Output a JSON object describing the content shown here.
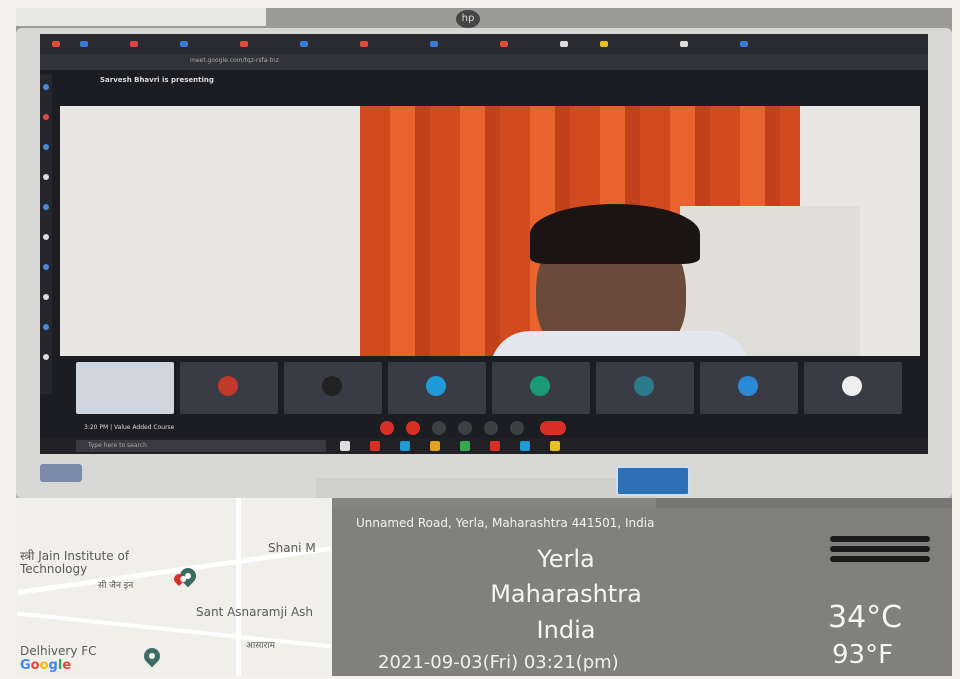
{
  "location": {
    "address": "Unnamed Road, Yerla, Maharashtra 441501, India",
    "city": "Yerla",
    "state": "Maharashtra",
    "country": "India",
    "datetime": "2021-09-03(Fri)  03:21(pm)"
  },
  "weather": {
    "celsius": "34°C",
    "fahrenheit": "93°F",
    "icon": "haze-icon"
  },
  "map": {
    "label_institute": "स्त्री Jain Institute of Technology",
    "label_institute_short": "सी जैन इन",
    "label_shani": "Shani M",
    "label_sant": "Sant Asnaramji Ash",
    "label_sant_native": "आसाराम",
    "label_delivery": "Delhivery FC",
    "brand": "Google",
    "colors": {
      "g1": "#4285f4",
      "g2": "#ea4335",
      "g3": "#fbbc05",
      "g4": "#34a853"
    }
  },
  "screen": {
    "presenting": "Sarvesh Bhavri is presenting",
    "url": "meet.google.com/tqz-rsfa-tnz",
    "meeting_info": "3:20 PM  |  Value Added Course",
    "taskbar_search": "Type here to search"
  }
}
